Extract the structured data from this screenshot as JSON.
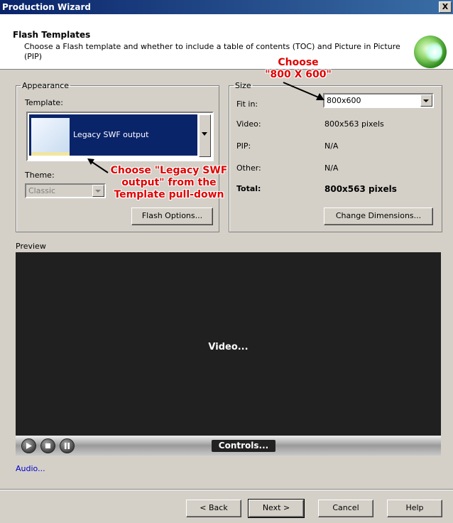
{
  "window": {
    "title": "Production Wizard",
    "close_label": "X"
  },
  "header": {
    "title": "Flash Templates",
    "description": "Choose a Flash template and whether to include a table of contents (TOC) and Picture in Picture (PIP)",
    "logo_icon": "camtasia-logo-icon"
  },
  "appearance": {
    "legend": "Appearance",
    "template_label": "Template:",
    "template_value": "Legacy SWF output",
    "theme_label": "Theme:",
    "theme_value": "Classic",
    "flash_options_button": "Flash Options..."
  },
  "size": {
    "legend": "Size",
    "fit_in_label": "Fit in:",
    "fit_in_value": "800x600",
    "video_label": "Video:",
    "video_value": "800x563 pixels",
    "pip_label": "PIP:",
    "pip_value": "N/A",
    "other_label": "Other:",
    "other_value": "N/A",
    "total_label": "Total:",
    "total_value": "800x563 pixels",
    "change_dimensions_button": "Change Dimensions..."
  },
  "preview": {
    "label": "Preview",
    "video_text": "Video...",
    "controls_text": "Controls...",
    "control_icons": [
      "play-icon",
      "stop-icon",
      "pause-icon"
    ]
  },
  "audio_link": "Audio...",
  "footer": {
    "back_button": "< Back",
    "next_button": "Next >",
    "cancel_button": "Cancel",
    "help_button": "Help"
  },
  "annotations": {
    "size_note_line1": "Choose",
    "size_note_line2": "\"800 X 600\"",
    "template_note_line1": "Choose \"Legacy SWF",
    "template_note_line2": "output\" from the",
    "template_note_line3": "Template pull-down",
    "color": "#e00000"
  }
}
